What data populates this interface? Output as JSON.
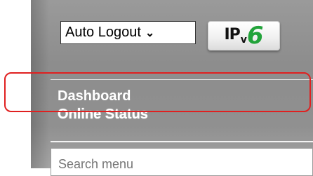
{
  "toolbar": {
    "auto_logout_selected": "Auto Logout",
    "ipv6_label": "IP",
    "ipv6_sub": "v",
    "ipv6_number": "6"
  },
  "nav": {
    "items": [
      {
        "label": "Dashboard"
      },
      {
        "label": "Online Status"
      }
    ]
  },
  "search": {
    "placeholder": "Search menu",
    "value": ""
  },
  "colors": {
    "highlight": "#e02020",
    "ipv6_green": "#22a33a",
    "sidebar_bg": "#8d8d8d"
  }
}
